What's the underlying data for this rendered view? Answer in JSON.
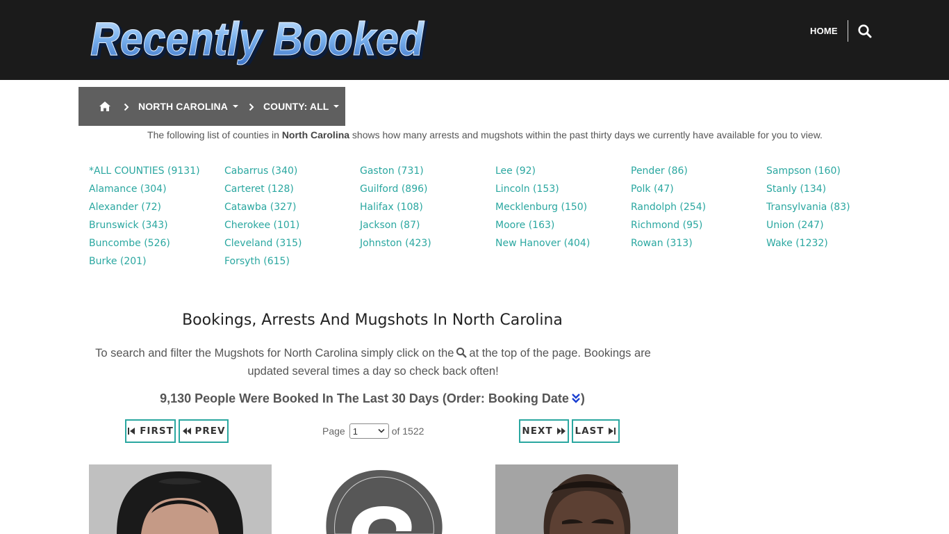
{
  "header": {
    "logo_text": "Recently Booked",
    "nav_home": "HOME",
    "search_icon": "search-icon"
  },
  "breadcrumb": {
    "home_icon": "home-icon",
    "state": "NORTH CAROLINA",
    "county": "COUNTY: ALL"
  },
  "intro": {
    "before": "The following list of counties in ",
    "state": "North Carolina",
    "after": " shows how many arrests and mugshots within the past thirty days we currently have available for you to view."
  },
  "counties": [
    [
      "*ALL COUNTIES (9131)",
      "Alamance (304)",
      "Alexander (72)",
      "Brunswick (343)",
      "Buncombe (526)",
      "Burke (201)"
    ],
    [
      "Cabarrus (340)",
      "Carteret (128)",
      "Catawba (327)",
      "Cherokee (101)",
      "Cleveland (315)",
      "Forsyth (615)"
    ],
    [
      "Gaston (731)",
      "Guilford (896)",
      "Halifax (108)",
      "Jackson (87)",
      "Johnston (423)"
    ],
    [
      "Lee (92)",
      "Lincoln (153)",
      "Mecklenburg (150)",
      "Moore (163)",
      "New Hanover (404)"
    ],
    [
      "Pender (86)",
      "Polk (47)",
      "Randolph (254)",
      "Richmond (95)",
      "Rowan (313)"
    ],
    [
      "Sampson (160)",
      "Stanly (134)",
      "Transylvania (83)",
      "Union (247)",
      "Wake (1232)"
    ]
  ],
  "section": {
    "title": "Bookings, Arrests And Mugshots In North Carolina",
    "desc_before": "To search and filter the Mugshots for North Carolina simply click on the",
    "desc_after": "at the top of the page. Bookings are updated several times a day so check back often!",
    "count_text": "9,130 People Were Booked In The Last 30 Days (Order: Booking Date",
    "count_close": ")"
  },
  "pager": {
    "first": "FIRST",
    "prev": "PREV",
    "page_label": "Page",
    "page_value": "1",
    "of_label": "of 1522",
    "next": "NEXT",
    "last": "LAST"
  },
  "colors": {
    "header_bg": "#1b1b1b",
    "breadcrumb_bg": "#5f5f5f",
    "accent": "#2aa7a0",
    "order_icon": "#1a3fd1"
  }
}
